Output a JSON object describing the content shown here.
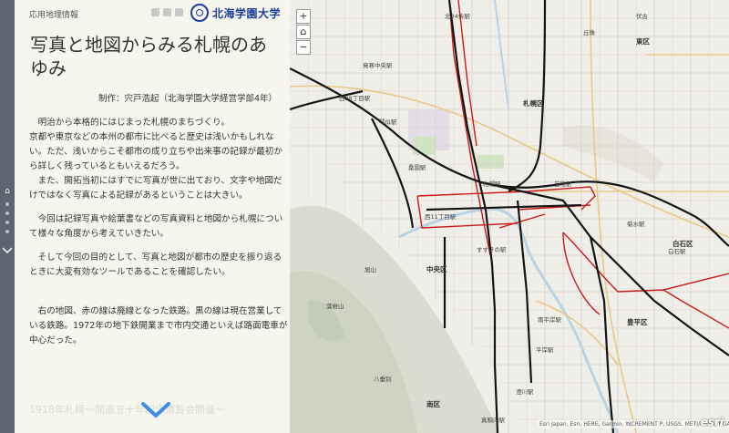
{
  "header": {
    "app_title": "応用地理情報",
    "logo_text": "北海学園大学"
  },
  "story": {
    "title": "写真と地図からみる札幌のあゆみ",
    "byline": "制作：宍戸浩起（北海学園大学経営学部4年）",
    "paragraphs": [
      "　明治から本格的にはじまった札幌のまちづくり。\n京都や東京などの本州の都市に比べると歴史は浅いかもしれない。ただ、浅いからこそ都市の成り立ちや出来事の記録が最初から詳しく残っているともいえるだろう。\n　また、開拓当初にはすでに写真が世に出ており、文字や地図だけではなく写真による記録があるということは大きい。",
      "　今回は記録写真や絵葉書などの写真資料と地図から札幌について様々な角度から考えていきたい。",
      "　そして今回の目的として、写真と地図が都市の歴史を振り返るときに大変有効なツールであることを確認したい。",
      "　右の地図、赤の線は廃線となった鉄路。黒の線は現在営業している鉄路。1972年の地下鉄開業まで市内交通といえば路面電車が中心だった。"
    ],
    "next_section": "1918年札幌～開道五十年記念博覧会開催～"
  },
  "map": {
    "zoom_in": "+",
    "zoom_out": "−",
    "attribution": "Esri Japan, Esri, HERE, Garmin, INCREMENT P, USGS, METI/NASA, NGA",
    "esri": "esri",
    "labels": {
      "sapporo_ward": "札幌区",
      "chuo_ward": "中央区",
      "toyohira_ward": "豊平区",
      "minami_ward": "南区",
      "higashi_ward": "東区",
      "shiroishi_ward": "白石区",
      "sapporo_st": "札幌駅",
      "kotoni_st": "琴似駅",
      "kuwazono_st": "桑園駅",
      "naebo_st": "苗穂駅",
      "nishi11_st": "西11丁目駅",
      "susukino_st": "すすきの駅",
      "hiragishi_st": "平岸駅",
      "sumikawa_st": "澄川駅",
      "makomanai_st": "真駒内駅",
      "kita24_st": "北24条駅",
      "hassamu_st": "発寒中央駅",
      "nishi28_st": "西28丁目駅",
      "kikusui_st": "菊水駅",
      "shiroishi_st": "白石駅",
      "minami_hiragishi_st": "南平岸駅",
      "fushiko": "伏古",
      "okadama": "丘珠",
      "mt_moiwa": "藻岩山",
      "asahiyama": "旭山",
      "yagisawa": "八垂別"
    }
  },
  "colors": {
    "nav_rail": "#5b6570",
    "panel_bg": "#f7f6ee",
    "active_rail": "#111111",
    "abandoned_rail": "#cc1a1a",
    "logo_blue": "#1d3f9c"
  }
}
